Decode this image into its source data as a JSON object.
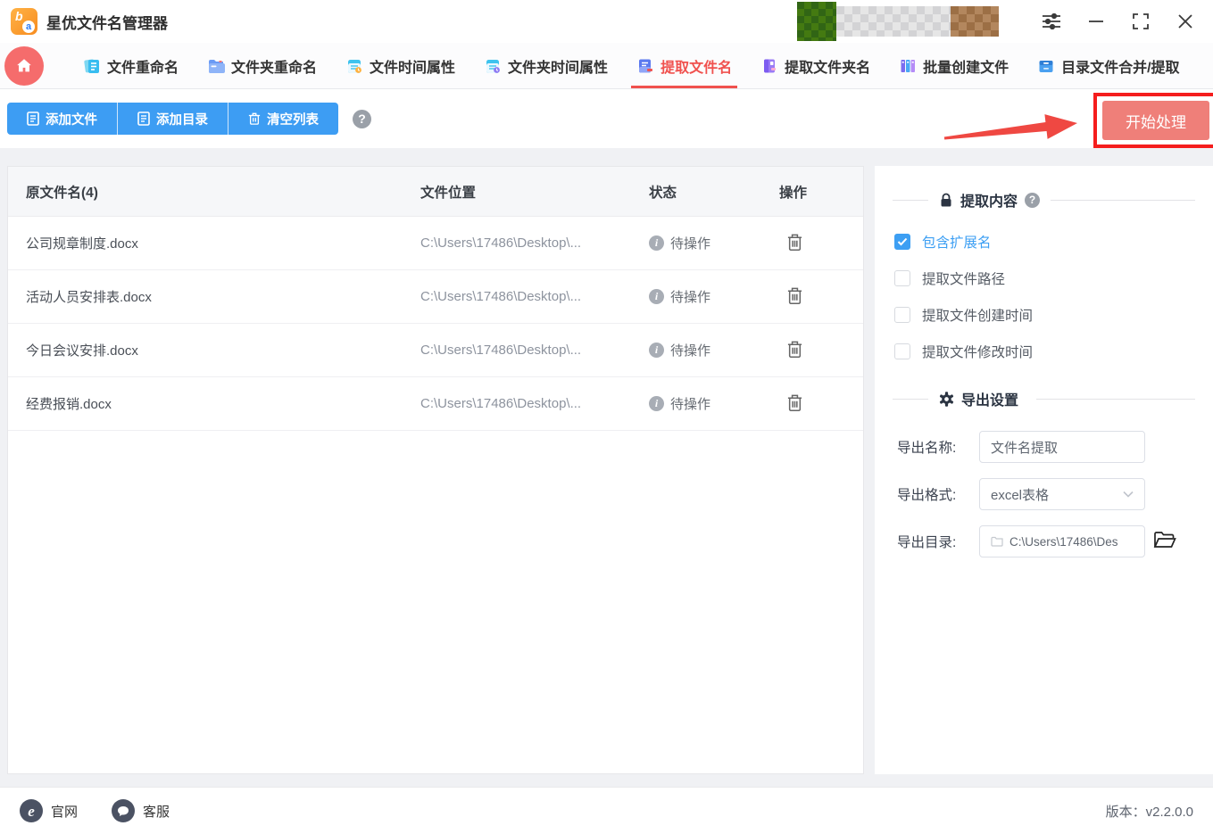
{
  "titlebar": {
    "app_title": "星优文件名管理器"
  },
  "nav": {
    "active_index": 4,
    "tabs": [
      {
        "label": "文件重命名"
      },
      {
        "label": "文件夹重命名"
      },
      {
        "label": "文件时间属性"
      },
      {
        "label": "文件夹时间属性"
      },
      {
        "label": "提取文件名"
      },
      {
        "label": "提取文件夹名"
      },
      {
        "label": "批量创建文件"
      },
      {
        "label": "目录文件合并/提取"
      }
    ]
  },
  "toolbar": {
    "add_file": "添加文件",
    "add_dir": "添加目录",
    "clear_list": "清空列表",
    "start": "开始处理"
  },
  "table": {
    "headers": {
      "name": "原文件名(4)",
      "location": "文件位置",
      "status": "状态",
      "action": "操作"
    },
    "rows": [
      {
        "name": "公司规章制度.docx",
        "path": "C:\\Users\\17486\\Desktop\\...",
        "status": "待操作"
      },
      {
        "name": "活动人员安排表.docx",
        "path": "C:\\Users\\17486\\Desktop\\...",
        "status": "待操作"
      },
      {
        "name": "今日会议安排.docx",
        "path": "C:\\Users\\17486\\Desktop\\...",
        "status": "待操作"
      },
      {
        "name": "经费报销.docx",
        "path": "C:\\Users\\17486\\Desktop\\...",
        "status": "待操作"
      }
    ]
  },
  "panel": {
    "extract_title": "提取内容",
    "options": [
      {
        "label": "包含扩展名",
        "checked": true
      },
      {
        "label": "提取文件路径",
        "checked": false
      },
      {
        "label": "提取文件创建时间",
        "checked": false
      },
      {
        "label": "提取文件修改时间",
        "checked": false
      }
    ],
    "export_title": "导出设置",
    "fields": {
      "name_label": "导出名称:",
      "name_value": "文件名提取",
      "format_label": "导出格式:",
      "format_value": "excel表格",
      "dir_label": "导出目录:",
      "dir_value": "C:\\Users\\17486\\Des"
    }
  },
  "footer": {
    "website": "官网",
    "support": "客服",
    "version": "版本：v2.2.0.0"
  },
  "glyphs": {
    "help": "?",
    "info": "i",
    "ie": "e"
  },
  "colors": {
    "accent_blue": "#3d9df3",
    "accent_red": "#f0514e",
    "annotation_red": "#f51d1d",
    "start_btn": "#ef7f79"
  }
}
